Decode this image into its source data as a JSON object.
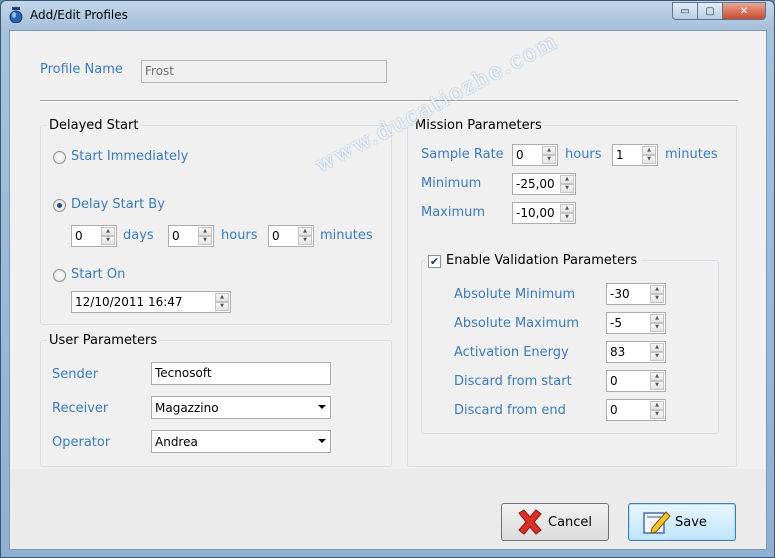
{
  "window": {
    "title": "Add/Edit Profiles",
    "minimize_glyph": "▭",
    "maximize_glyph": "▢",
    "close_glyph": "✕"
  },
  "profile": {
    "label": "Profile Name",
    "value": "Frost"
  },
  "delayed_start": {
    "title": "Delayed Start",
    "start_immediately": "Start Immediately",
    "delay_start_by": "Delay Start By",
    "days_value": "0",
    "days_label": "days",
    "hours_value": "0",
    "hours_label": "hours",
    "minutes_value": "0",
    "minutes_label": "minutes",
    "start_on": "Start On",
    "start_on_value": "12/10/2011 16:47",
    "selected": "delay_start_by"
  },
  "user_parameters": {
    "title": "User Parameters",
    "sender_label": "Sender",
    "sender_value": "Tecnosoft",
    "receiver_label": "Receiver",
    "receiver_value": "Magazzino",
    "operator_label": "Operator",
    "operator_value": "Andrea"
  },
  "mission_parameters": {
    "title": "Mission Parameters",
    "sample_rate_label": "Sample Rate",
    "sample_hours_value": "0",
    "hours_label": "hours",
    "sample_minutes_value": "1",
    "minutes_label": "minutes",
    "minimum_label": "Minimum",
    "minimum_value": "-25,00",
    "maximum_label": "Maximum",
    "maximum_value": "-10,00"
  },
  "validation": {
    "enable_label": "Enable Validation Parameters",
    "enabled": true,
    "abs_min_label": "Absolute Minimum",
    "abs_min_value": "-30",
    "abs_max_label": "Absolute Maximum",
    "abs_max_value": "-5",
    "activation_label": "Activation Energy",
    "activation_value": "83",
    "discard_start_label": "Discard from start",
    "discard_start_value": "0",
    "discard_end_label": "Discard from end",
    "discard_end_value": "0"
  },
  "buttons": {
    "cancel": "Cancel",
    "save": "Save"
  },
  "watermark": "www.ducatiozhe.com",
  "colors": {
    "label": "#3b7bbd",
    "client": "#f0f0f0",
    "frame": "#a9c3de"
  }
}
